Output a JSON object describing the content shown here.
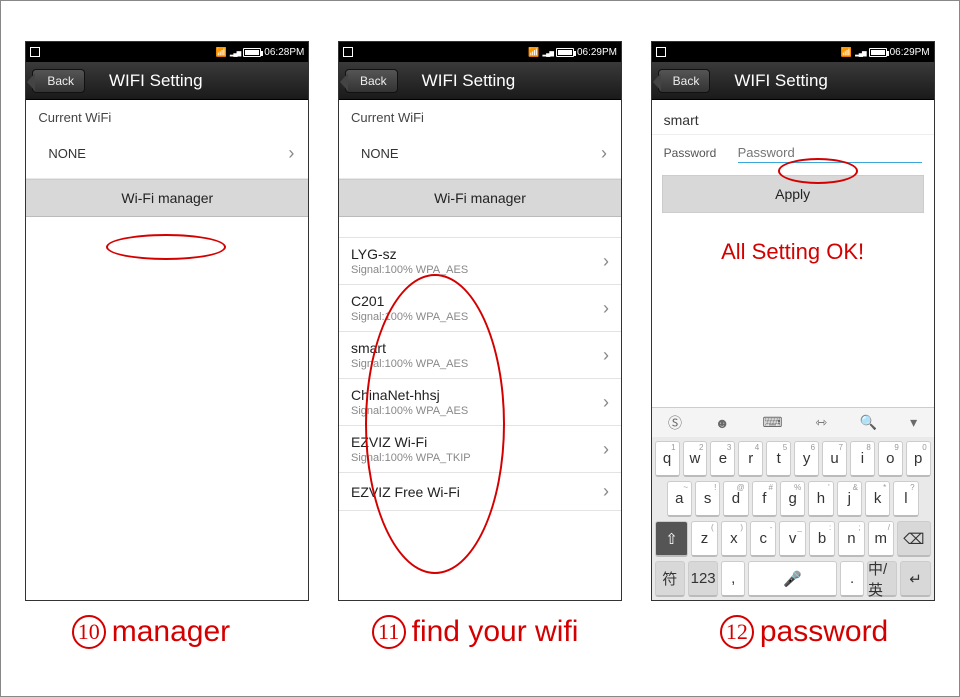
{
  "screens": [
    {
      "status_time": "06:28PM",
      "back": "Back",
      "title": "WIFI Setting",
      "current_wifi_label": "Current WiFi",
      "current_wifi_value": "NONE",
      "manager_btn": "Wi-Fi manager"
    },
    {
      "status_time": "06:29PM",
      "back": "Back",
      "title": "WIFI Setting",
      "current_wifi_label": "Current WiFi",
      "current_wifi_value": "NONE",
      "manager_btn": "Wi-Fi manager",
      "networks": [
        {
          "name": "LYG-sz",
          "sub": "Signal:100%    WPA_AES"
        },
        {
          "name": "C201",
          "sub": "Signal:100%    WPA_AES"
        },
        {
          "name": "smart",
          "sub": "Signal:100%    WPA_AES"
        },
        {
          "name": "ChinaNet-hhsj",
          "sub": "Signal:100%    WPA_AES"
        },
        {
          "name": "EZVIZ Wi-Fi",
          "sub": "Signal:100%    WPA_TKIP"
        },
        {
          "name": "EZVIZ Free Wi-Fi",
          "sub": ""
        }
      ]
    },
    {
      "status_time": "06:29PM",
      "back": "Back",
      "title": "WIFI Setting",
      "selected_wifi": "smart",
      "password_label": "Password",
      "password_placeholder": "Password",
      "apply_btn": "Apply",
      "all_ok": "All Setting OK!",
      "keyboard": {
        "row1": [
          "q",
          "w",
          "e",
          "r",
          "t",
          "y",
          "u",
          "i",
          "o",
          "p"
        ],
        "row1_mini": [
          "1",
          "2",
          "3",
          "4",
          "5",
          "6",
          "7",
          "8",
          "9",
          "0"
        ],
        "row2": [
          "a",
          "s",
          "d",
          "f",
          "g",
          "h",
          "j",
          "k",
          "l"
        ],
        "row2_mini": [
          "~",
          "!",
          "@",
          "#",
          "%",
          "'",
          "&",
          "*",
          "?"
        ],
        "row3_keys": [
          "z",
          "x",
          "c",
          "v",
          "b",
          "n",
          "m"
        ],
        "row3_mini": [
          "(",
          ")",
          "-",
          "_",
          ":",
          ";",
          "/"
        ],
        "shift": "⇧",
        "bksp": "⌫",
        "sym": "符",
        "num": "123",
        "comma": ",",
        "mic": "🎤",
        "period": ".",
        "lang": "中/英",
        "enter": "↵"
      }
    }
  ],
  "captions": [
    {
      "num": "10",
      "text": "manager"
    },
    {
      "num": "11",
      "text": "find  your wifi"
    },
    {
      "num": "12",
      "text": "password"
    }
  ]
}
